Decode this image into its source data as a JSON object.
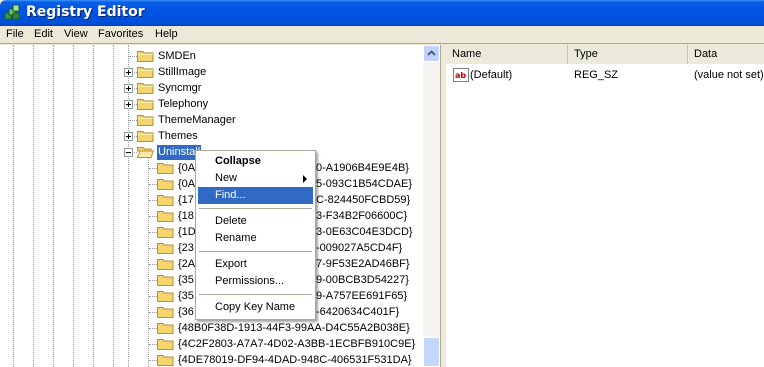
{
  "window": {
    "title": "Registry Editor"
  },
  "menu": [
    "File",
    "Edit",
    "View",
    "Favorites",
    "Help"
  ],
  "tree": {
    "items": [
      {
        "label": "SMDEn",
        "expander": "none",
        "depth": 1
      },
      {
        "label": "StillImage",
        "expander": "plus",
        "depth": 1
      },
      {
        "label": "Syncmgr",
        "expander": "plus",
        "depth": 1
      },
      {
        "label": "Telephony",
        "expander": "plus",
        "depth": 1
      },
      {
        "label": "ThemeManager",
        "expander": "none",
        "depth": 1
      },
      {
        "label": "Themes",
        "expander": "plus",
        "depth": 1
      },
      {
        "label": "Uninstall",
        "expander": "minus",
        "depth": 1,
        "selected": true
      },
      {
        "label": "{0A",
        "suffix": "0-A1906B4E9E4B}",
        "depth": 2
      },
      {
        "label": "{0A",
        "suffix": "5-093C1B54CDAE}",
        "depth": 2
      },
      {
        "label": "{17",
        "suffix": "C-824450FCBD59}",
        "depth": 2
      },
      {
        "label": "{18",
        "suffix": "3-F34B2F06600C}",
        "depth": 2
      },
      {
        "label": "{1D",
        "suffix": "3-0E63C04E3DCD}",
        "depth": 2
      },
      {
        "label": "{23",
        "suffix": "-009027A5CD4F}",
        "depth": 2
      },
      {
        "label": "{2A",
        "suffix": "7-9F53E2AD46BF}",
        "depth": 2
      },
      {
        "label": "{35",
        "suffix": "9-00BCB3D54227}",
        "depth": 2
      },
      {
        "label": "{35",
        "suffix": "9-A757EE691F65}",
        "depth": 2
      },
      {
        "label": "{36",
        "suffix": "-6420634C401F}",
        "depth": 2
      },
      {
        "label": "{48B0F38D-1913-44F3-99AA-D4C55A2B038E}",
        "depth": 2
      },
      {
        "label": "{4C2F2803-A7A7-4D02-A3BB-1ECBFB910C9E}",
        "depth": 2
      },
      {
        "label": "{4DE78019-DF94-4DAD-948C-406531F531DA}",
        "depth": 2
      }
    ]
  },
  "list": {
    "columns": [
      "Name",
      "Type",
      "Data"
    ],
    "rows": [
      {
        "name": "(Default)",
        "type": "REG_SZ",
        "data": "(value not set)",
        "icon": "string-value-icon"
      }
    ]
  },
  "context_menu": {
    "items": [
      {
        "label": "Collapse",
        "bold": true
      },
      {
        "label": "New",
        "submenu": true
      },
      {
        "label": "Find...",
        "highlighted": true
      },
      {
        "separator": true
      },
      {
        "label": "Delete"
      },
      {
        "label": "Rename"
      },
      {
        "separator": true
      },
      {
        "label": "Export"
      },
      {
        "label": "Permissions..."
      },
      {
        "separator": true
      },
      {
        "label": "Copy Key Name"
      }
    ]
  },
  "colors": {
    "titlebar": "#0054E3",
    "selection": "#316AC5",
    "window_face": "#ECE9D8"
  }
}
